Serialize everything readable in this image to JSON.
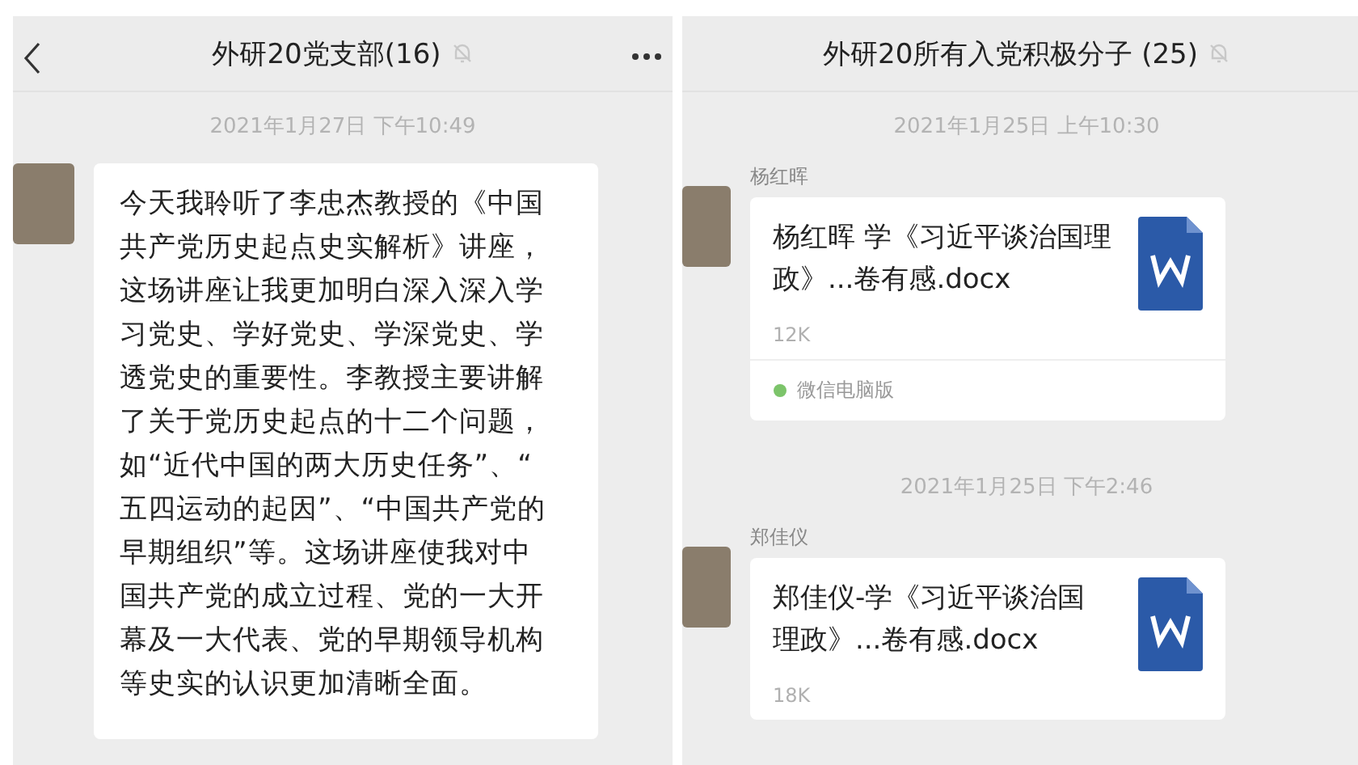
{
  "chats": [
    {
      "title": "外研20党支部(16)",
      "muted": true,
      "back": true,
      "messages": [
        {
          "kind": "time",
          "text": "2021年1月27日 下午10:49"
        },
        {
          "kind": "text",
          "lines": [
            "今天我聆听了李忠杰教授的《中国",
            "共产党历史起点史实解析》讲座，",
            "这场讲座让我更加明白深入深入学",
            "习党史、学好党史、学深党史、学",
            "透党史的重要性。李教授主要讲解",
            "了关于党历史起点的十二个问题，",
            "如“近代中国的两大历史任务”、“",
            "五四运动的起因”、“中国共产党的",
            "早期组织”等。这场讲座使我对中",
            "国共产党的成立过程、党的一大开",
            "幕及一大代表、党的早期领导机构",
            "等史实的认识更加清晰全面。"
          ]
        }
      ]
    },
    {
      "title": "外研20所有入党积极分子 (25)",
      "muted": true,
      "back": false,
      "messages": [
        {
          "kind": "time",
          "text": "2021年1月25日 上午10:30"
        },
        {
          "kind": "file",
          "sender": "杨红晖",
          "file_name": "杨红晖 学《习近平谈治国理政》...卷有感.docx",
          "size": "12K",
          "source": "微信电脑版"
        },
        {
          "kind": "time",
          "text": "2021年1月25日 下午2:46"
        },
        {
          "kind": "file",
          "sender": "郑佳仪",
          "file_name": "郑佳仪-学《习近平谈治国理政》...卷有感.docx",
          "size": "18K"
        }
      ]
    }
  ]
}
